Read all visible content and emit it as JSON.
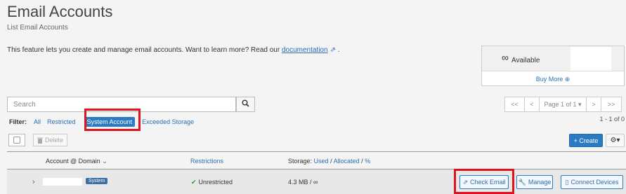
{
  "header": {
    "title": "Email Accounts",
    "subtitle": "List Email Accounts"
  },
  "intro": {
    "text": "This feature lets you create and manage email accounts. Want to learn more? Read our",
    "link": "documentation",
    "trailing": "."
  },
  "stats": {
    "infinity": "∞",
    "available_label": "Available",
    "buy_more": "Buy More ⊕"
  },
  "search": {
    "placeholder": "Search",
    "value": ""
  },
  "pagination": {
    "first": "<<",
    "prev": "<",
    "page_label": "Page 1 of 1 ▾",
    "next": ">",
    "last": ">>",
    "count": "1 - 1 of 0"
  },
  "filter": {
    "label": "Filter:",
    "options": [
      "All",
      "Restricted",
      "System Account",
      "Exceeded Storage"
    ],
    "active": "System Account"
  },
  "toolbar": {
    "delete_label": "Delete",
    "create_label": "+ Create",
    "gear_label": "⚙▾"
  },
  "table": {
    "headers": {
      "account": "Account @ Domain",
      "restrictions": "Restrictions",
      "storage_prefix": "Storage:",
      "storage_used": "Used",
      "storage_allocated": "Allocated",
      "storage_percent": "%"
    },
    "rows": [
      {
        "expand": "›",
        "badge": "System",
        "restrictions": "Unrestricted",
        "storage": "4.3 MB / ∞",
        "actions": {
          "check_email": "Check Email",
          "manage": "Manage",
          "connect_devices": "Connect Devices"
        }
      }
    ]
  },
  "colors": {
    "accent": "#2a7bc1",
    "highlight": "#e0141e",
    "background": "#f4f4f4"
  }
}
